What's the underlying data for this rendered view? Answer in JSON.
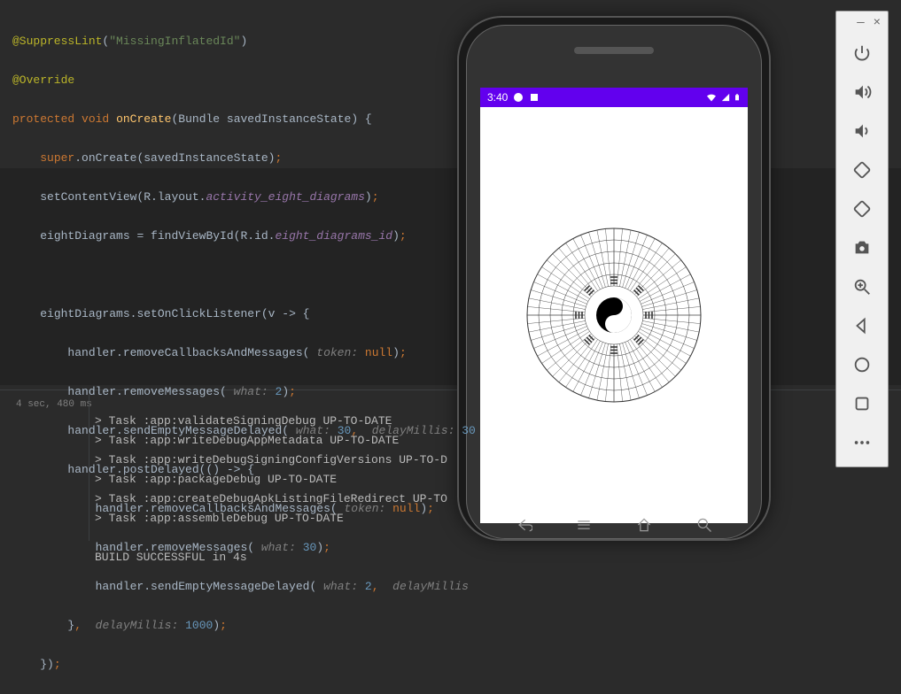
{
  "code": {
    "l1_anno": "@SuppressLint",
    "l1_str": "\"MissingInflatedId\"",
    "l2_anno": "@Override",
    "l3_kw1": "protected",
    "l3_kw2": "void",
    "l3_fn": "onCreate",
    "l3_sig": "(Bundle savedInstanceState) {",
    "l4_super": "super",
    "l4_call": ".onCreate(savedInstanceState)",
    "l5_fn": "setContentView(R.layout.",
    "l5_it": "activity_eight_diagrams",
    "l5_end": ")",
    "l6_lhs": "eightDiagrams",
    "l6_mid": " = findViewById(R.id.",
    "l6_it": "eight_diagrams_id",
    "l6_end": ")",
    "l8_lhs": "eightDiagrams",
    "l8_call": ".setOnClickListener(v -> {",
    "l9_h": "handler",
    "l9_call": ".removeCallbacksAndMessages(",
    "l9_p": "token:",
    "l9_null": "null",
    "l9_end": ")",
    "l10_h": "handler",
    "l10_call": ".removeMessages(",
    "l10_p": "what:",
    "l10_n": "2",
    "l10_end": ")",
    "l11_h": "handler",
    "l11_call": ".sendEmptyMessageDelayed(",
    "l11_p1": "what:",
    "l11_n1": "30",
    "l11_p2": "delayMillis:",
    "l11_n2": "30",
    "l12_h": "handler",
    "l12_call": ".postDelayed(() -> {",
    "l13_h": "handler",
    "l13_call": ".removeCallbacksAndMessages(",
    "l13_p": "token:",
    "l13_null": "null",
    "l13_end": ")",
    "l14_h": "handler",
    "l14_call": ".removeMessages(",
    "l14_p": "what:",
    "l14_n": "30",
    "l14_end": ")",
    "l15_h": "handler",
    "l15_call": ".sendEmptyMessageDelayed(",
    "l15_p1": "what:",
    "l15_n1": "2",
    "l15_p2": "delayMillis",
    "l16_close": "}",
    "l16_p": "delayMillis:",
    "l16_n": "1000",
    "l16_end": ")",
    "l17_close": "})",
    "semicolon": ";",
    "comma": ",",
    "paren_close": ")"
  },
  "build": {
    "time": "4 sec, 480 ms",
    "lines": [
      "> Task :app:validateSigningDebug UP-TO-DATE",
      "> Task :app:writeDebugAppMetadata UP-TO-DATE",
      "> Task :app:writeDebugSigningConfigVersions UP-TO-D",
      "> Task :app:packageDebug UP-TO-DATE",
      "> Task :app:createDebugApkListingFileRedirect UP-TO",
      "> Task :app:assembleDebug UP-TO-DATE",
      "",
      "BUILD SUCCESSFUL in 4s"
    ]
  },
  "statusbar": {
    "time": "3:40"
  },
  "panel": {
    "min": "—",
    "close": "×"
  }
}
